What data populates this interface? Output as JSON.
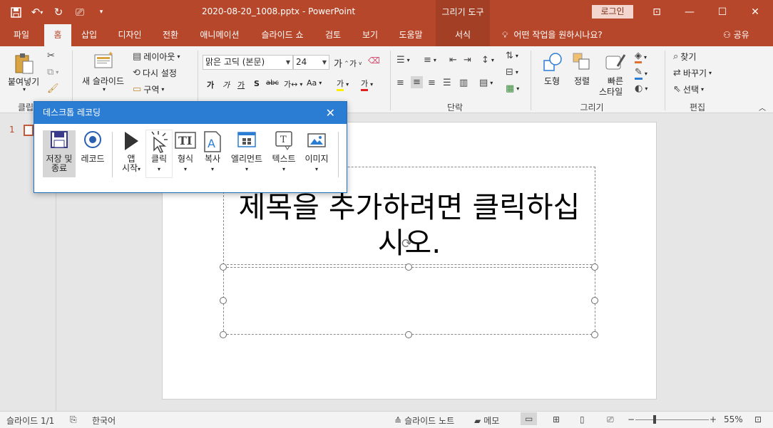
{
  "titlebar": {
    "doc_title": "2020-08-20_1008.pptx  -  PowerPoint",
    "context_title": "그리기 도구",
    "login": "로그인"
  },
  "tabs": [
    {
      "label": "파일"
    },
    {
      "label": "홈"
    },
    {
      "label": "삽입"
    },
    {
      "label": "디자인"
    },
    {
      "label": "전환"
    },
    {
      "label": "애니메이션"
    },
    {
      "label": "슬라이드 쇼"
    },
    {
      "label": "검토"
    },
    {
      "label": "보기"
    },
    {
      "label": "도움말"
    },
    {
      "label": "서식"
    }
  ],
  "tell_me": "어떤 작업을 원하시나요?",
  "share": "공유",
  "ribbon": {
    "clipboard": {
      "paste": "붙여넣기",
      "group": "클립보"
    },
    "slides": {
      "new_slide": "새 슬라이드",
      "layout": "레이아웃",
      "reset": "다시 설정",
      "section": "구역"
    },
    "font": {
      "font_name": "맑은 고딕 (본문)",
      "font_size": "24"
    },
    "paragraph": {
      "group": "단락"
    },
    "drawing": {
      "shapes": "도형",
      "arrange": "정렬",
      "quick_styles_1": "빠른",
      "quick_styles_2": "스타일",
      "group": "그리기"
    },
    "editing": {
      "find": "찾기",
      "replace": "바꾸기",
      "select": "선택",
      "group": "편집"
    }
  },
  "slide_panel": {
    "slide_number": "1"
  },
  "slide": {
    "title_placeholder": "제목을 추가하려면 클릭하십시오."
  },
  "dialog": {
    "title": "데스크톱 레코딩",
    "buttons": [
      {
        "label": "저장 및\n종료"
      },
      {
        "label": "레코드"
      },
      {
        "label": "앱\n시작"
      },
      {
        "label": "클릭"
      },
      {
        "label": "형식"
      },
      {
        "label": "복사"
      },
      {
        "label": "엘리먼트"
      },
      {
        "label": "텍스트"
      },
      {
        "label": "이미지"
      }
    ]
  },
  "status": {
    "slide_info": "슬라이드 1/1",
    "language": "한국어",
    "notes": "슬라이드 노트",
    "comments": "메모",
    "zoom": "55%"
  },
  "colors": {
    "accent": "#b7472a",
    "dialog_header": "#2b7cd3"
  }
}
